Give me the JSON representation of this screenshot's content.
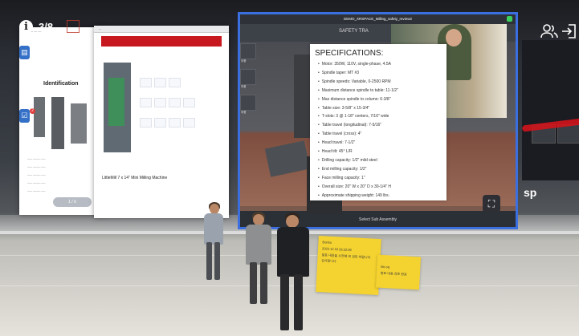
{
  "hud": {
    "page_indicator": "3/8",
    "info_icon": "info-icon",
    "users_icon": "users-icon",
    "exit_icon": "exit-icon"
  },
  "left_panel": {
    "title": "Identification",
    "pager": "1 / 6",
    "edge_buttons": [
      "document-icon",
      "checklist-icon"
    ],
    "badge": "2"
  },
  "web_panel": {
    "heading": "LittleMill 7 x 14\" Mini Milling Machine"
  },
  "main_panel": {
    "title": "DEMO_XRSPACE_Milling_safety_review2",
    "tab": "SAFETY TRA",
    "bottom_label": "Select Sub Assembly",
    "side_labels": [
      "부품",
      "부품",
      "부품"
    ],
    "specs_title": "SPECIFICATIONS:",
    "specs": [
      "Motor: 350W, 110V, single-phase, 4.5A",
      "Spindle taper: MT #3",
      "Spindle speeds: Variable, 0-2500 RPM",
      "Maximum distance spindle to table: 11-1/2\"",
      "Max distance spindle to column: 6-3/8\"",
      "Table size: 3-5/8\" x 15-3/4\"",
      "T-slots: 3 @ 1-18\" centers, 7/16\" wide",
      "Table travel (longitudinal): 7-5/16\"",
      "Table travel (cross): 4\"",
      "Head travel: 7-1/2\"",
      "Head tilt: 45° L/R",
      "Drilling capacity: 1/2\" mild steel",
      "End milling capacity: 1/2\"",
      "Face milling capacity: 1\"",
      "Overall size: 20\" W x 20\" D x 30-1/4\" H",
      "Approximate shipping weight: 149 lbs."
    ]
  },
  "notes": [
    {
      "author": "Bonbo",
      "date": "2022.12.16 03:22:09",
      "lines": [
        "발표 내용을 사전에 꼭 검토 바랍니다",
        "감사합니다"
      ]
    },
    {
      "author": "",
      "date": "",
      "lines": [
        "Bn-oq",
        "발표 내용 검토 완료"
      ]
    }
  ],
  "backdrop_sign": "sp"
}
